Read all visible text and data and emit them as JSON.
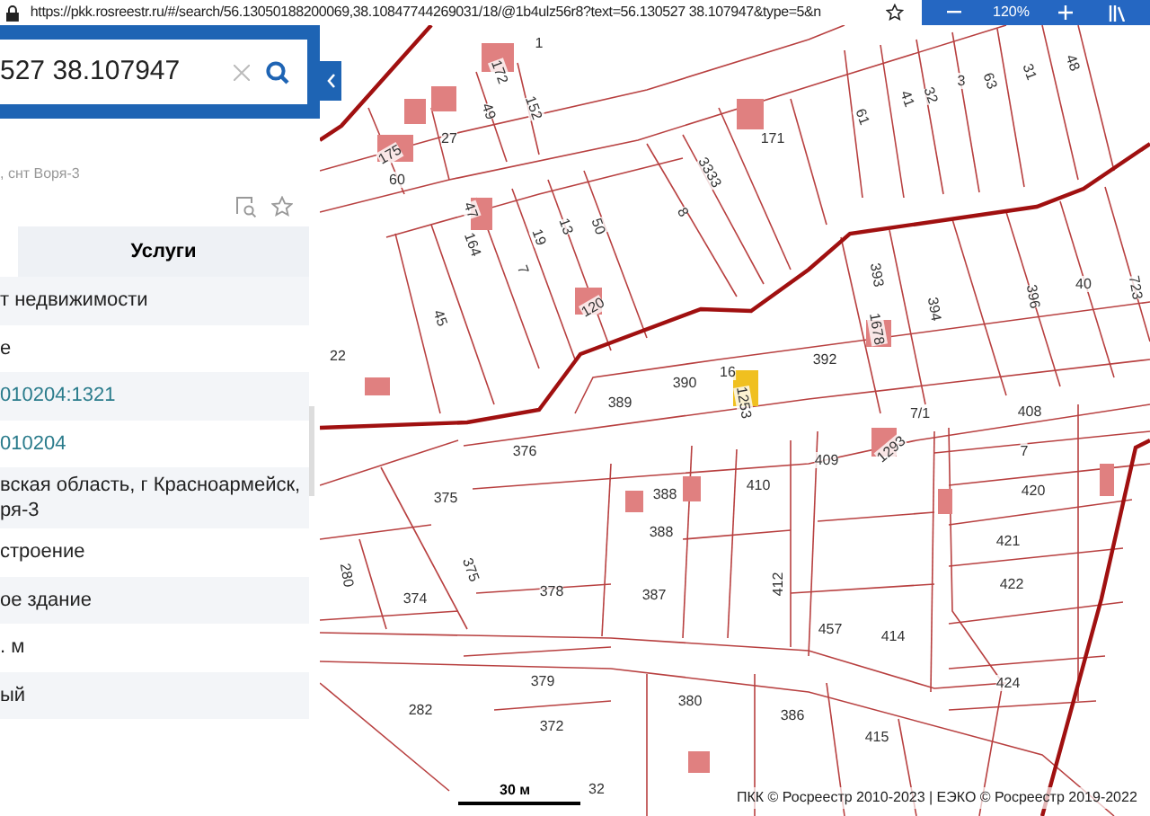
{
  "browser": {
    "url": "https://pkk.rosreestr.ru/#/search/56.13050188200069,38.10847744269031/18/@1b4ulz56r8?text=56.130527 38.107947&type=5&n",
    "zoom": "120%"
  },
  "search": {
    "value": "527 38.107947"
  },
  "address": ", снт Воря-3",
  "tabs": [
    {
      "label": "Услуги",
      "selected": false
    }
  ],
  "rows": [
    {
      "kind": "text",
      "text": "т недвижимости"
    },
    {
      "kind": "text",
      "text": "е"
    },
    {
      "kind": "link",
      "text": "010204:1321"
    },
    {
      "kind": "link",
      "text": "010204"
    },
    {
      "kind": "text",
      "text": "вская область, г Красноармейск,\nря-3"
    },
    {
      "kind": "text",
      "text": "строение"
    },
    {
      "kind": "text",
      "text": "ое здание"
    },
    {
      "kind": "text",
      "text": ". м"
    },
    {
      "kind": "text",
      "text": "ый"
    }
  ],
  "map": {
    "parcels": [
      {
        "label": "1"
      },
      {
        "label": "172"
      },
      {
        "label": "152"
      },
      {
        "label": "49"
      },
      {
        "label": "27"
      },
      {
        "label": "175"
      },
      {
        "label": "60"
      },
      {
        "label": "171"
      },
      {
        "label": "61"
      },
      {
        "label": "41"
      },
      {
        "label": "32"
      },
      {
        "label": "3"
      },
      {
        "label": "63"
      },
      {
        "label": "31"
      },
      {
        "label": "48"
      },
      {
        "label": "3333"
      },
      {
        "label": "8"
      },
      {
        "label": "50"
      },
      {
        "label": "13"
      },
      {
        "label": "19"
      },
      {
        "label": "7"
      },
      {
        "label": "47"
      },
      {
        "label": "164"
      },
      {
        "label": "45"
      },
      {
        "label": "120"
      },
      {
        "label": "22"
      },
      {
        "label": "393"
      },
      {
        "label": "1678"
      },
      {
        "label": "394"
      },
      {
        "label": "396"
      },
      {
        "label": "40"
      },
      {
        "label": "723"
      },
      {
        "label": "392"
      },
      {
        "label": "390"
      },
      {
        "label": "16"
      },
      {
        "label": "389"
      },
      {
        "label": "1253"
      },
      {
        "label": "7/1"
      },
      {
        "label": "408"
      },
      {
        "label": "7"
      },
      {
        "label": "420"
      },
      {
        "label": "376"
      },
      {
        "label": "375"
      },
      {
        "label": "388"
      },
      {
        "label": "388"
      },
      {
        "label": "410"
      },
      {
        "label": "409"
      },
      {
        "label": "1293"
      },
      {
        "label": "421"
      },
      {
        "label": "422"
      },
      {
        "label": "280"
      },
      {
        "label": "374"
      },
      {
        "label": "375"
      },
      {
        "label": "378"
      },
      {
        "label": "387"
      },
      {
        "label": "412"
      },
      {
        "label": "457"
      },
      {
        "label": "414"
      },
      {
        "label": "424"
      },
      {
        "label": "379"
      },
      {
        "label": "282"
      },
      {
        "label": "372"
      },
      {
        "label": "380"
      },
      {
        "label": "386"
      },
      {
        "label": "415"
      },
      {
        "label": "32"
      }
    ],
    "scale": "30 м",
    "copyright": "ПКК © Росреестр 2010-2023 | ЕЭКО © Росреестр 2019-2022"
  }
}
